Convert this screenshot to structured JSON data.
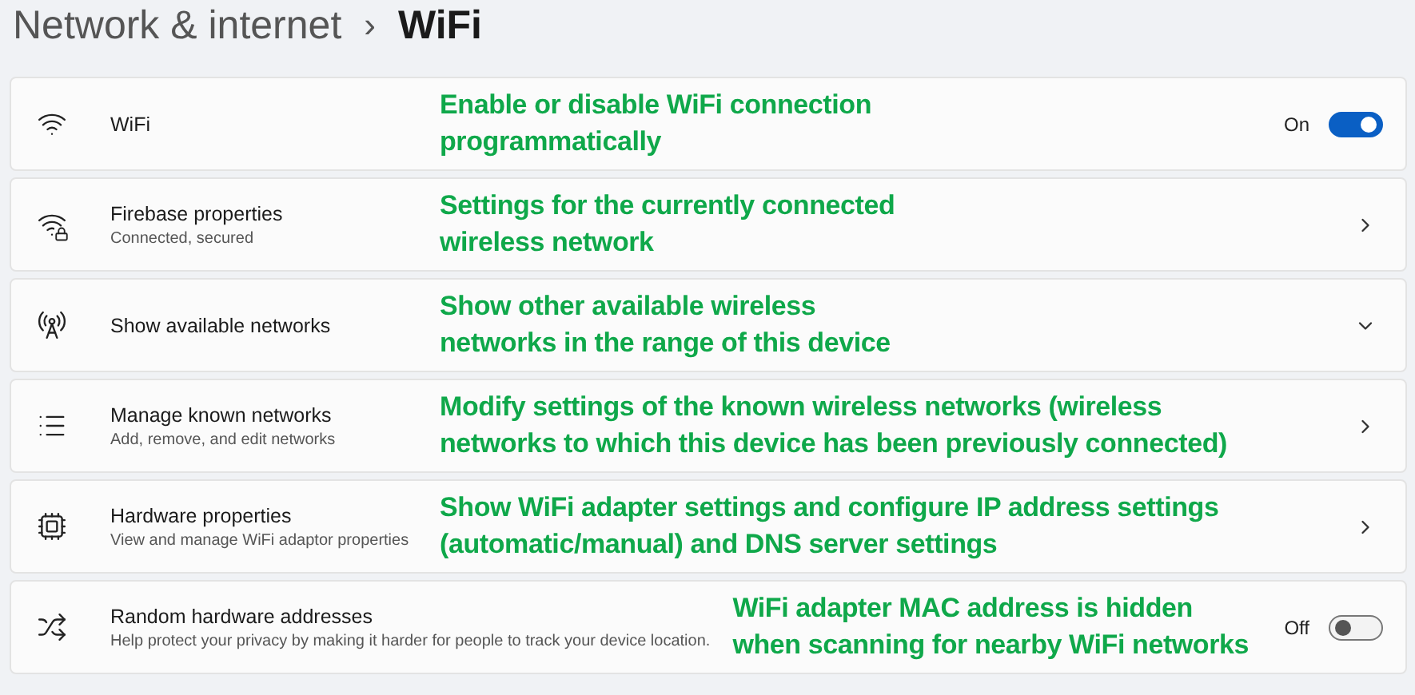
{
  "breadcrumb": {
    "parent": "Network & internet",
    "separator": "›",
    "current": "WiFi"
  },
  "rows": [
    {
      "kind": "toggle",
      "title": "WiFi",
      "state_text": "On",
      "on": true,
      "annotation": "Enable or disable WiFi connection\nprogrammatically"
    },
    {
      "kind": "link",
      "title": "Firebase properties",
      "subtitle": "Connected, secured",
      "annotation": "Settings for the currently connected\nwireless network"
    },
    {
      "kind": "expand",
      "title": "Show available networks",
      "annotation": "Show other available wireless\nnetworks in the range of this device"
    },
    {
      "kind": "link",
      "title": "Manage known networks",
      "subtitle": "Add, remove, and edit networks",
      "annotation": "Modify settings of the known wireless networks (wireless\nnetworks to which this device has been previously connected)"
    },
    {
      "kind": "link",
      "title": "Hardware properties",
      "subtitle": "View and manage WiFi adaptor properties",
      "annotation": "Show WiFi adapter settings and configure IP address settings\n(automatic/manual) and DNS server settings"
    },
    {
      "kind": "toggle",
      "title": "Random hardware addresses",
      "subtitle": "Help protect your privacy by making it harder for people to track your device location.",
      "state_text": "Off",
      "on": false,
      "annotation": "WiFi adapter MAC address is hidden\nwhen scanning for nearby WiFi networks"
    }
  ]
}
